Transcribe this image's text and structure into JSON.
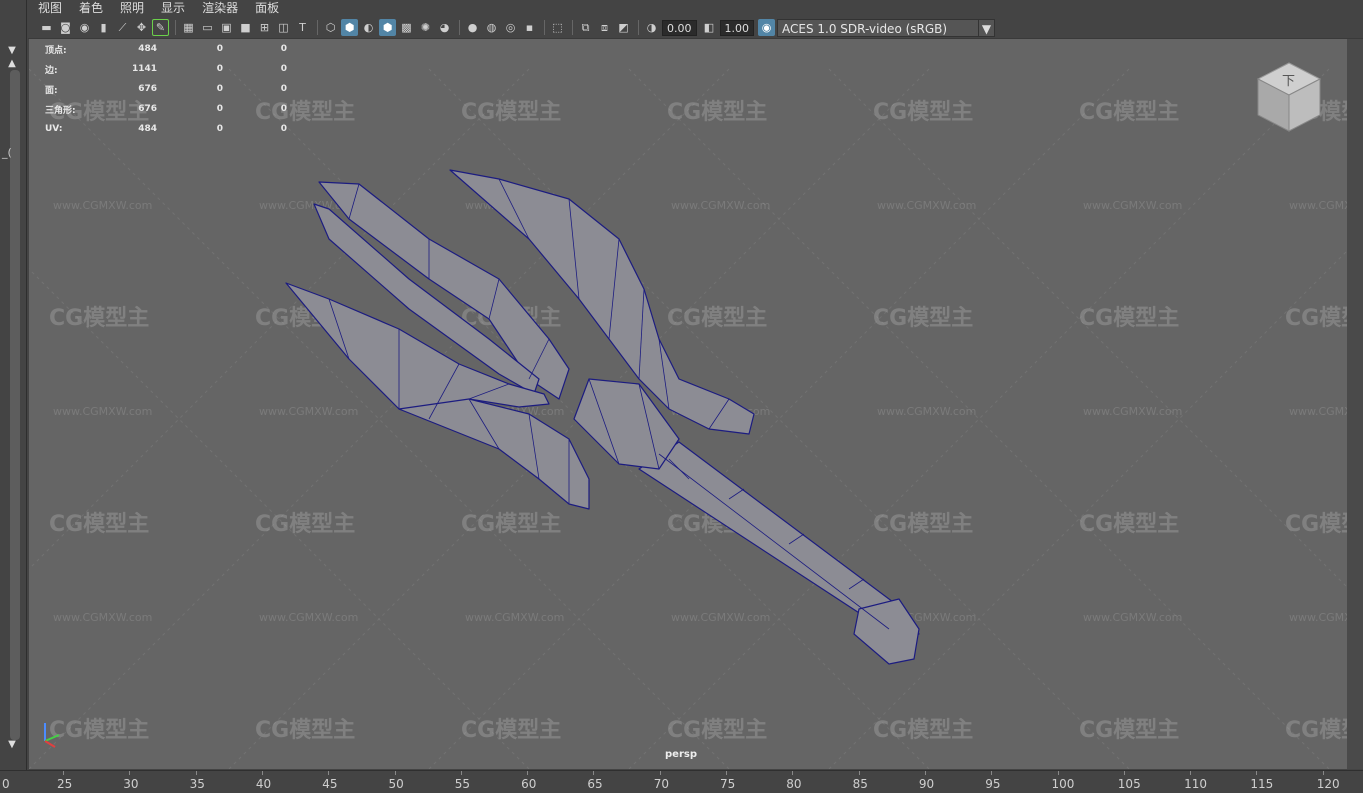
{
  "menu": [
    "视图",
    "着色",
    "照明",
    "显示",
    "渲染器",
    "面板"
  ],
  "toolbar": {
    "icons": [
      "camera-icon",
      "camera-attr-icon",
      "bookmark-camera-icon",
      "bookmark-icon",
      "image-plane-icon",
      "2d-pan-icon",
      "grease-pencil-icon",
      "grid-icon",
      "film-gate-icon",
      "resolution-gate-icon",
      "gate-mask-icon",
      "field-chart-icon",
      "safe-action-icon",
      "safe-title-icon",
      "wireframe-icon",
      "smooth-shade-icon",
      "default-material-icon",
      "wireframe-on-shaded-icon",
      "xray-icon",
      "use-all-lights-icon",
      "shadows-icon",
      "screen-space-ao-icon",
      "motion-blur-icon",
      "multisample-aa-icon",
      "depth-of-field-icon",
      "isolate-select-icon",
      "xray-joints-icon",
      "xray-active-icon",
      "backface-icon",
      "exposure-icon",
      "gamma-icon",
      "color-management-icon"
    ],
    "exposure": "0.00",
    "gamma": "1.00",
    "color_space": "ACES 1.0 SDR-video (sRGB)"
  },
  "hud": [
    {
      "label": "顶点:",
      "v1": "484",
      "v2": "0",
      "v3": "0"
    },
    {
      "label": "边:",
      "v1": "1141",
      "v2": "0",
      "v3": "0"
    },
    {
      "label": "面:",
      "v1": "676",
      "v2": "0",
      "v3": "0"
    },
    {
      "label": "三角形:",
      "v1": "676",
      "v2": "0",
      "v3": "0"
    },
    {
      "label": "UV:",
      "v1": "484",
      "v2": "0",
      "v3": "0"
    }
  ],
  "watermark": {
    "logo": "CG模型主",
    "url": "www.CGMXW.com"
  },
  "viewport": {
    "camera": "persp",
    "view_cube_face": "下"
  },
  "left_strip_text": "_(",
  "timeline": {
    "ticks": [
      "25",
      "30",
      "35",
      "40",
      "45",
      "50",
      "55",
      "60",
      "65",
      "70",
      "75",
      "80",
      "85",
      "90",
      "95",
      "100",
      "105",
      "110",
      "115",
      "120"
    ],
    "left_edge": "0"
  },
  "colors": {
    "wire": "#1a1a7a",
    "mesh": "#8a8a92",
    "viewport_bg": "#656565",
    "accent": "#5285a6"
  }
}
